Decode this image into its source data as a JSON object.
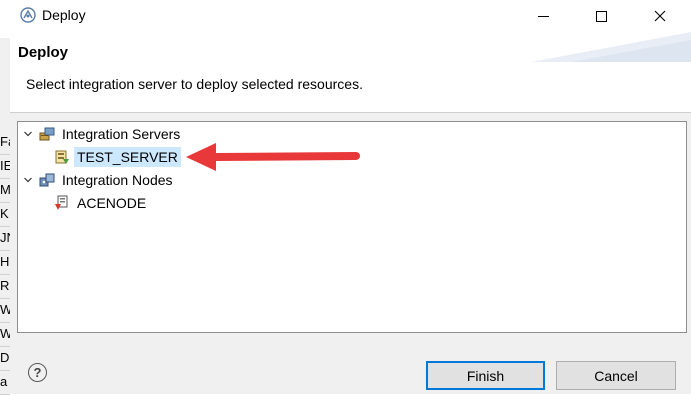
{
  "left_strip": [
    "Fa",
    "IE",
    "M",
    "K",
    "JN",
    "H",
    "R",
    "W",
    "W",
    "D",
    "a"
  ],
  "window": {
    "title": "Deploy"
  },
  "header": {
    "title": "Deploy",
    "message": "Select integration server to deploy selected resources."
  },
  "tree": {
    "servers_group": "Integration Servers",
    "server": "TEST_SERVER",
    "nodes_group": "Integration Nodes",
    "node": "ACENODE"
  },
  "buttons": {
    "finish": "Finish",
    "cancel": "Cancel"
  },
  "colors": {
    "selection": "#cce8ff",
    "accent": "#0078d7",
    "arrow": "#e8383a"
  }
}
